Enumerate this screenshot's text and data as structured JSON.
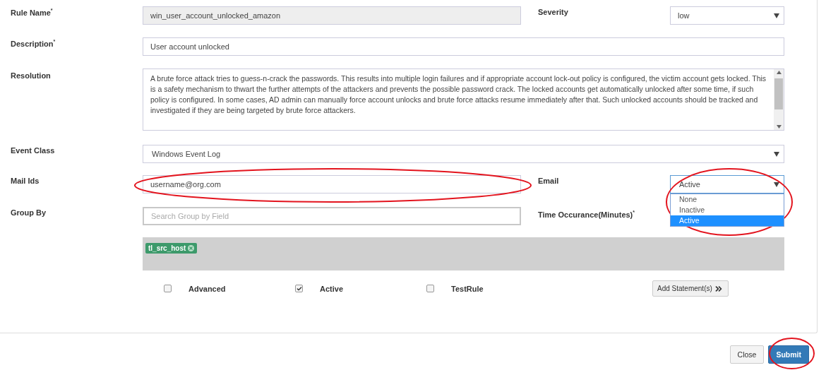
{
  "rule_name": {
    "label": "Rule Name$^{*}$",
    "value": "win_user_account_unlocked_amazon",
    "disabled": true
  },
  "severity": {
    "label": "Severity",
    "value": "low"
  },
  "description": {
    "label": "Description$^{*}$",
    "value": "User account unlocked"
  },
  "resolution": {
    "label": "Resolution",
    "value": "A brute force attack tries to guess-n-crack the passwords. This results into multiple login failures and if appropriate account lock-out policy is configured, the victim account gets locked. This is a safety mechanism to thwart the further attempts of the attackers and prevents the possible password crack. The locked accounts get automatically unlocked after some time, if such policy is configured. In some cases, AD admin can manually force account unlocks and brute force attacks resume immediately after that. Such unlocked accounts should be tracked and investigated if they are being targeted by brute force attackers."
  },
  "event_class": {
    "label": "Event Class",
    "value": "Windows Event Log"
  },
  "mail_ids": {
    "label": "Mail Ids",
    "value": "username@org.com"
  },
  "email": {
    "label": "Email",
    "value": "Active",
    "expanded": true,
    "options": [
      {
        "label": "None",
        "selected": false
      },
      {
        "label": "Inactive",
        "selected": false
      },
      {
        "label": "Active",
        "selected": true
      }
    ]
  },
  "group_by": {
    "label": "Group By",
    "placeholder": "Search Group by Field",
    "tags": [
      "tl_src_host"
    ]
  },
  "time_occurance": {
    "label": "Time Occurance(Minutes)$^{*}$"
  },
  "options": [
    {
      "label": "Advanced",
      "checked": false
    },
    {
      "label": "Active",
      "checked": true
    },
    {
      "label": "TestRule",
      "checked": false
    }
  ],
  "add_statement": {
    "label": "Add Statement(s)"
  },
  "footer_buttons": [
    {
      "label": "Close",
      "kind": "default"
    },
    {
      "label": "Submit",
      "kind": "primary"
    }
  ]
}
